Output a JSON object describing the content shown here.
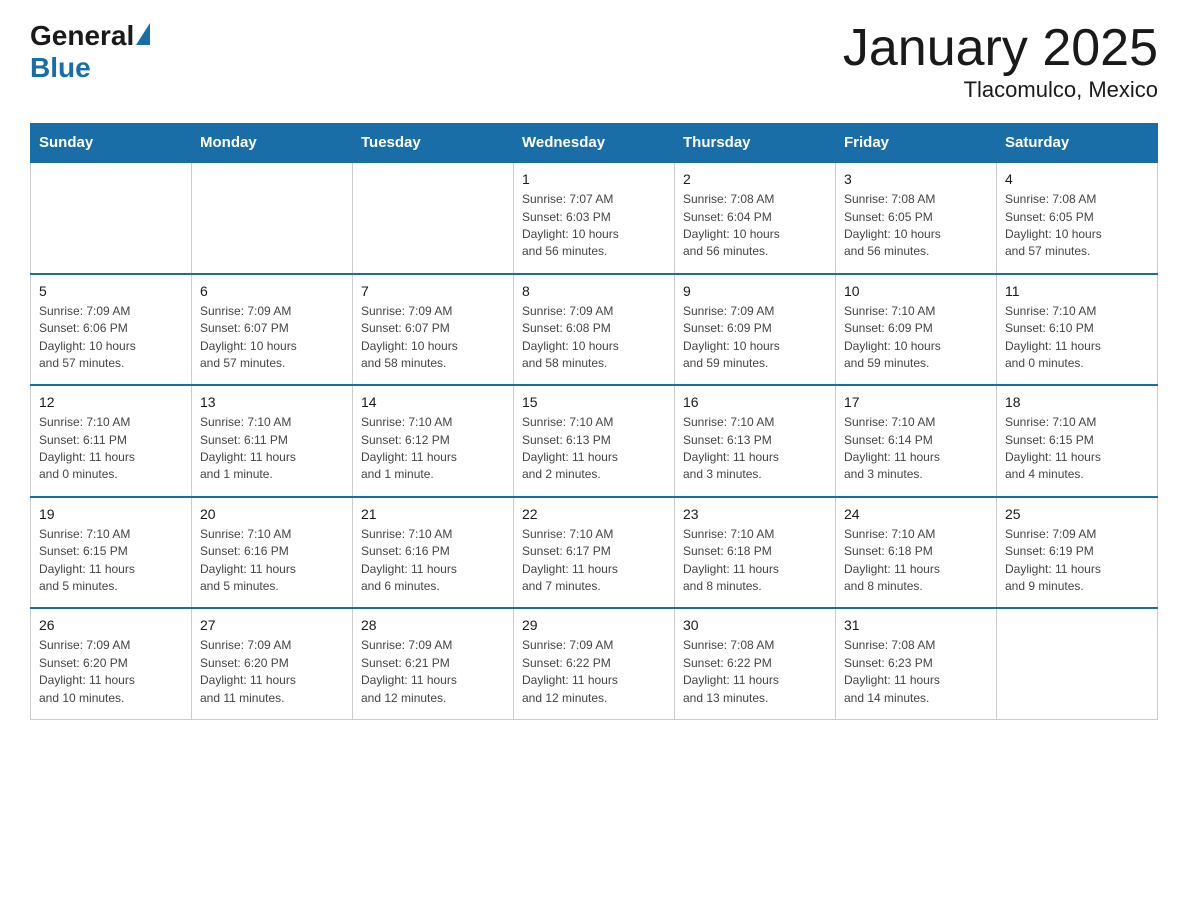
{
  "header": {
    "logo_general": "General",
    "logo_blue": "Blue",
    "title": "January 2025",
    "subtitle": "Tlacomulco, Mexico"
  },
  "days_of_week": [
    "Sunday",
    "Monday",
    "Tuesday",
    "Wednesday",
    "Thursday",
    "Friday",
    "Saturday"
  ],
  "weeks": [
    [
      {
        "day": "",
        "info": ""
      },
      {
        "day": "",
        "info": ""
      },
      {
        "day": "",
        "info": ""
      },
      {
        "day": "1",
        "info": "Sunrise: 7:07 AM\nSunset: 6:03 PM\nDaylight: 10 hours\nand 56 minutes."
      },
      {
        "day": "2",
        "info": "Sunrise: 7:08 AM\nSunset: 6:04 PM\nDaylight: 10 hours\nand 56 minutes."
      },
      {
        "day": "3",
        "info": "Sunrise: 7:08 AM\nSunset: 6:05 PM\nDaylight: 10 hours\nand 56 minutes."
      },
      {
        "day": "4",
        "info": "Sunrise: 7:08 AM\nSunset: 6:05 PM\nDaylight: 10 hours\nand 57 minutes."
      }
    ],
    [
      {
        "day": "5",
        "info": "Sunrise: 7:09 AM\nSunset: 6:06 PM\nDaylight: 10 hours\nand 57 minutes."
      },
      {
        "day": "6",
        "info": "Sunrise: 7:09 AM\nSunset: 6:07 PM\nDaylight: 10 hours\nand 57 minutes."
      },
      {
        "day": "7",
        "info": "Sunrise: 7:09 AM\nSunset: 6:07 PM\nDaylight: 10 hours\nand 58 minutes."
      },
      {
        "day": "8",
        "info": "Sunrise: 7:09 AM\nSunset: 6:08 PM\nDaylight: 10 hours\nand 58 minutes."
      },
      {
        "day": "9",
        "info": "Sunrise: 7:09 AM\nSunset: 6:09 PM\nDaylight: 10 hours\nand 59 minutes."
      },
      {
        "day": "10",
        "info": "Sunrise: 7:10 AM\nSunset: 6:09 PM\nDaylight: 10 hours\nand 59 minutes."
      },
      {
        "day": "11",
        "info": "Sunrise: 7:10 AM\nSunset: 6:10 PM\nDaylight: 11 hours\nand 0 minutes."
      }
    ],
    [
      {
        "day": "12",
        "info": "Sunrise: 7:10 AM\nSunset: 6:11 PM\nDaylight: 11 hours\nand 0 minutes."
      },
      {
        "day": "13",
        "info": "Sunrise: 7:10 AM\nSunset: 6:11 PM\nDaylight: 11 hours\nand 1 minute."
      },
      {
        "day": "14",
        "info": "Sunrise: 7:10 AM\nSunset: 6:12 PM\nDaylight: 11 hours\nand 1 minute."
      },
      {
        "day": "15",
        "info": "Sunrise: 7:10 AM\nSunset: 6:13 PM\nDaylight: 11 hours\nand 2 minutes."
      },
      {
        "day": "16",
        "info": "Sunrise: 7:10 AM\nSunset: 6:13 PM\nDaylight: 11 hours\nand 3 minutes."
      },
      {
        "day": "17",
        "info": "Sunrise: 7:10 AM\nSunset: 6:14 PM\nDaylight: 11 hours\nand 3 minutes."
      },
      {
        "day": "18",
        "info": "Sunrise: 7:10 AM\nSunset: 6:15 PM\nDaylight: 11 hours\nand 4 minutes."
      }
    ],
    [
      {
        "day": "19",
        "info": "Sunrise: 7:10 AM\nSunset: 6:15 PM\nDaylight: 11 hours\nand 5 minutes."
      },
      {
        "day": "20",
        "info": "Sunrise: 7:10 AM\nSunset: 6:16 PM\nDaylight: 11 hours\nand 5 minutes."
      },
      {
        "day": "21",
        "info": "Sunrise: 7:10 AM\nSunset: 6:16 PM\nDaylight: 11 hours\nand 6 minutes."
      },
      {
        "day": "22",
        "info": "Sunrise: 7:10 AM\nSunset: 6:17 PM\nDaylight: 11 hours\nand 7 minutes."
      },
      {
        "day": "23",
        "info": "Sunrise: 7:10 AM\nSunset: 6:18 PM\nDaylight: 11 hours\nand 8 minutes."
      },
      {
        "day": "24",
        "info": "Sunrise: 7:10 AM\nSunset: 6:18 PM\nDaylight: 11 hours\nand 8 minutes."
      },
      {
        "day": "25",
        "info": "Sunrise: 7:09 AM\nSunset: 6:19 PM\nDaylight: 11 hours\nand 9 minutes."
      }
    ],
    [
      {
        "day": "26",
        "info": "Sunrise: 7:09 AM\nSunset: 6:20 PM\nDaylight: 11 hours\nand 10 minutes."
      },
      {
        "day": "27",
        "info": "Sunrise: 7:09 AM\nSunset: 6:20 PM\nDaylight: 11 hours\nand 11 minutes."
      },
      {
        "day": "28",
        "info": "Sunrise: 7:09 AM\nSunset: 6:21 PM\nDaylight: 11 hours\nand 12 minutes."
      },
      {
        "day": "29",
        "info": "Sunrise: 7:09 AM\nSunset: 6:22 PM\nDaylight: 11 hours\nand 12 minutes."
      },
      {
        "day": "30",
        "info": "Sunrise: 7:08 AM\nSunset: 6:22 PM\nDaylight: 11 hours\nand 13 minutes."
      },
      {
        "day": "31",
        "info": "Sunrise: 7:08 AM\nSunset: 6:23 PM\nDaylight: 11 hours\nand 14 minutes."
      },
      {
        "day": "",
        "info": ""
      }
    ]
  ]
}
